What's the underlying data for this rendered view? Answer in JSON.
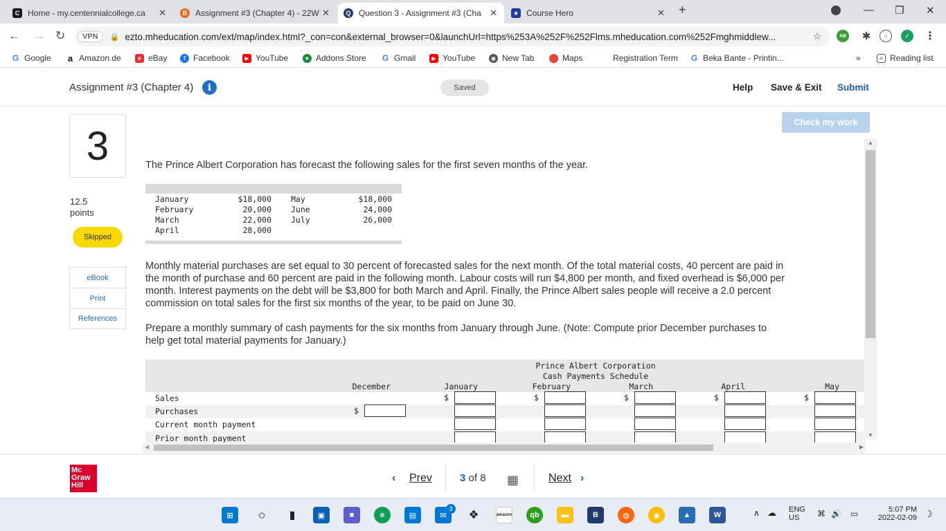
{
  "browser": {
    "tabs": [
      {
        "title": "Home - my.centennialcollege.ca",
        "icon": "C"
      },
      {
        "title": "Assignment #3 (Chapter 4) - 22W",
        "icon": "B"
      },
      {
        "title": "Question 3 - Assignment #3 (Cha",
        "icon": "Q"
      },
      {
        "title": "Course Hero",
        "icon": "★"
      }
    ],
    "url": "ezto.mheducation.com/ext/map/index.html?_con=con&external_browser=0&launchUrl=https%253A%252F%252Flms.mheducation.com%252Fmghmiddlew...",
    "vpn_label": "VPN",
    "bookmarks": [
      "Google",
      "Amazon.de",
      "eBay",
      "Facebook",
      "YouTube",
      "Addons Store",
      "Gmail",
      "YouTube",
      "New Tab",
      "Maps",
      "Registration Term",
      "Beka Bante - Printin..."
    ],
    "bookmark_more": "»",
    "reading_list": "Reading list"
  },
  "header": {
    "title": "Assignment #3 (Chapter 4)",
    "status": "Saved",
    "help": "Help",
    "save_exit": "Save & Exit",
    "submit": "Submit"
  },
  "question": {
    "number": "3",
    "points_value": "12.5",
    "points_label": "points",
    "status_badge": "Skipped",
    "check_my_work": "Check my work",
    "tools": [
      "eBook",
      "Print",
      "References"
    ],
    "intro": "The Prince Albert Corporation has forecast the following sales for the first seven months of the year.",
    "sales_forecast": {
      "left": [
        {
          "month": "January",
          "value": "$18,000"
        },
        {
          "month": "February",
          "value": "20,000"
        },
        {
          "month": "March",
          "value": "22,000"
        },
        {
          "month": "April",
          "value": "28,000"
        }
      ],
      "right": [
        {
          "month": "May",
          "value": "$18,000"
        },
        {
          "month": "June",
          "value": "24,000"
        },
        {
          "month": "July",
          "value": "26,000"
        }
      ]
    },
    "para1": "Monthly material purchases are set equal to 30 percent of forecasted sales for the next month. Of the total material costs, 40 percent are paid in the month of purchase and 60 percent are paid in the following month. Labour costs will run $4,800 per month, and fixed overhead is $6,000 per month. Interest payments on the debt will be $3,800 for both March and April. Finally, the Prince Albert sales people will receive a 2.0 percent commission on total sales for the first six months of the year, to be paid on June 30.",
    "para2": "Prepare a monthly summary of cash payments for the six months from January through June. (Note: Compute prior December purchases to help get total material payments for January.)"
  },
  "schedule": {
    "company": "Prince Albert Corporation",
    "title": "Cash Payments Schedule",
    "columns": [
      "December",
      "January",
      "February",
      "March",
      "April",
      "May"
    ],
    "rows": [
      "Sales",
      "Purchases",
      "Current month payment",
      "Prior month payment"
    ],
    "currency": "$"
  },
  "footer": {
    "logo": [
      "Mc",
      "Graw",
      "Hill"
    ],
    "prev": "Prev",
    "page_current": "3",
    "page_of": "of",
    "page_total": "8",
    "next": "Next"
  },
  "taskbar": {
    "lang": "ENG",
    "region": "US",
    "time": "5:07 PM",
    "date": "2022-02-09",
    "mail_badge": "3"
  }
}
